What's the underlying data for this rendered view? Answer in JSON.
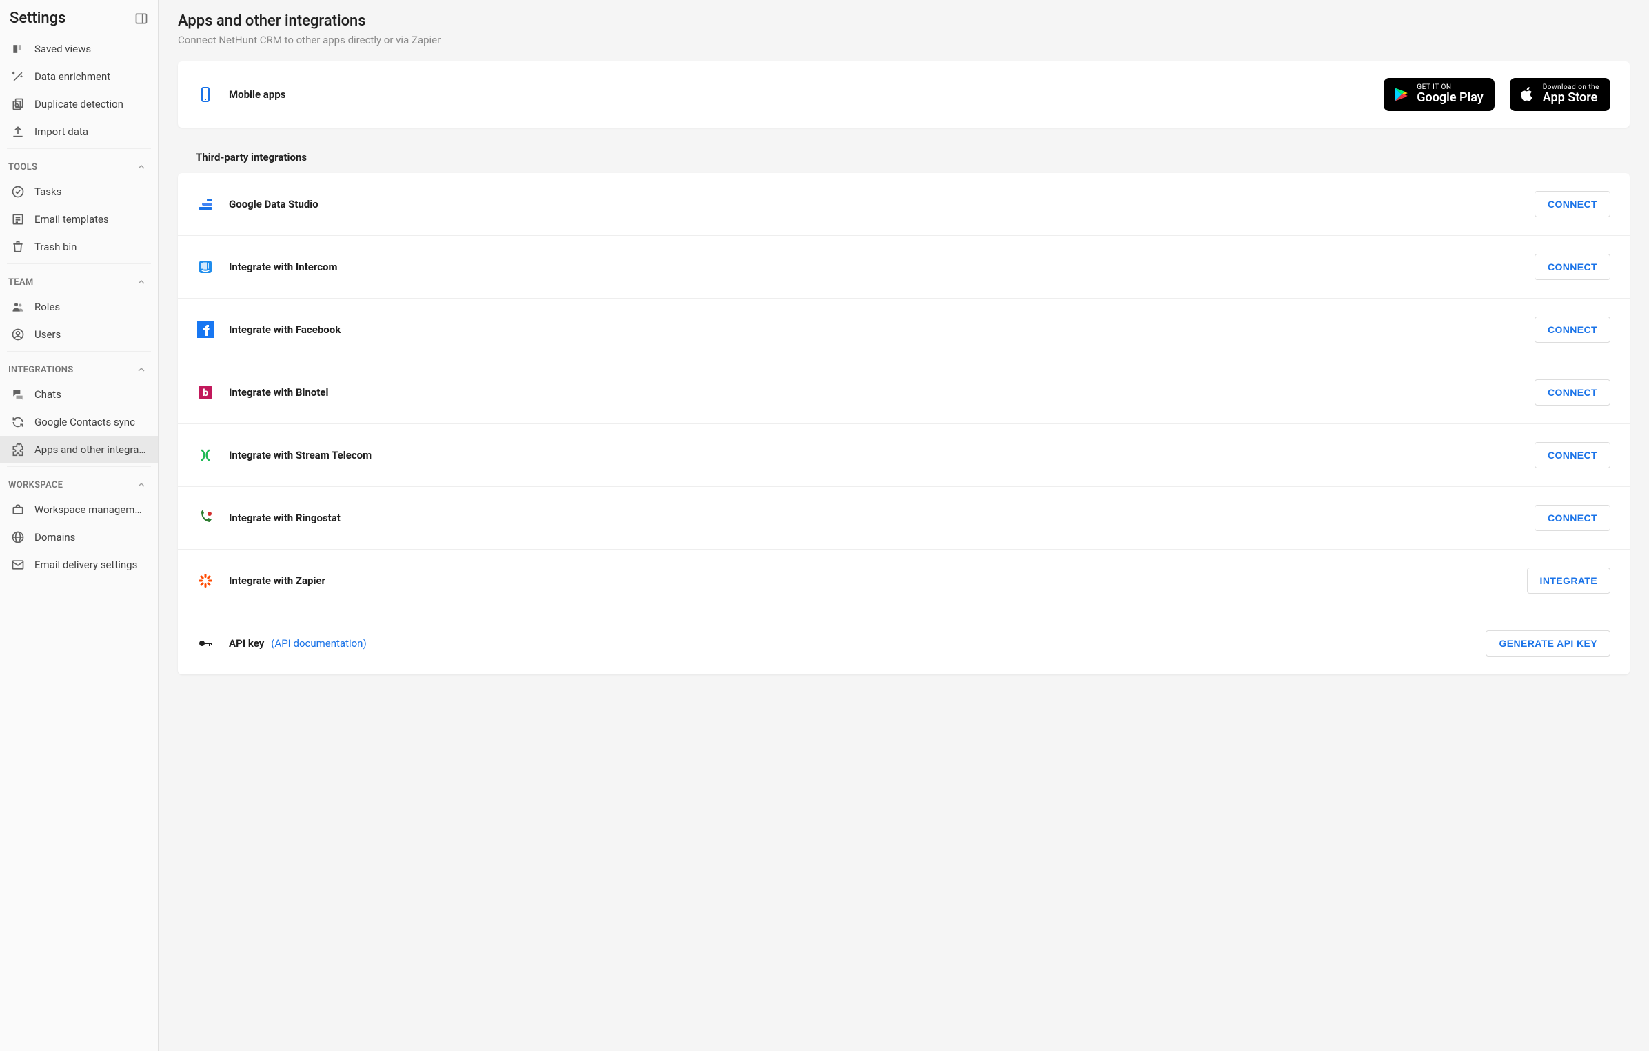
{
  "sidebar": {
    "title": "Settings",
    "top_items": [
      {
        "id": "saved-views",
        "label": "Saved views"
      },
      {
        "id": "data-enrichment",
        "label": "Data enrichment"
      },
      {
        "id": "duplicate-detection",
        "label": "Duplicate detection"
      },
      {
        "id": "import-data",
        "label": "Import data"
      }
    ],
    "sections": [
      {
        "id": "tools",
        "label": "TOOLS",
        "items": [
          {
            "id": "tasks",
            "label": "Tasks"
          },
          {
            "id": "email-templates",
            "label": "Email templates"
          },
          {
            "id": "trash-bin",
            "label": "Trash bin"
          }
        ]
      },
      {
        "id": "team",
        "label": "TEAM",
        "items": [
          {
            "id": "roles",
            "label": "Roles"
          },
          {
            "id": "users",
            "label": "Users"
          }
        ]
      },
      {
        "id": "integrations",
        "label": "INTEGRATIONS",
        "items": [
          {
            "id": "chats",
            "label": "Chats"
          },
          {
            "id": "google-contacts-sync",
            "label": "Google Contacts sync"
          },
          {
            "id": "apps-other-integrations",
            "label": "Apps and other integra…",
            "active": true
          }
        ]
      },
      {
        "id": "workspace",
        "label": "WORKSPACE",
        "items": [
          {
            "id": "workspace-management",
            "label": "Workspace manageme…"
          },
          {
            "id": "domains",
            "label": "Domains"
          },
          {
            "id": "email-delivery-settings",
            "label": "Email delivery settings"
          }
        ]
      }
    ]
  },
  "main": {
    "title": "Apps and other integrations",
    "subtitle": "Connect NetHunt CRM to other apps directly or via Zapier",
    "mobile": {
      "label": "Mobile apps",
      "google": {
        "line1": "GET IT ON",
        "line2": "Google Play"
      },
      "apple": {
        "line1": "Download on the",
        "line2": "App Store"
      }
    },
    "third_party_label": "Third-party integrations",
    "integrations": [
      {
        "id": "google-data-studio",
        "label": "Google Data Studio",
        "button": "CONNECT"
      },
      {
        "id": "intercom",
        "label": "Integrate with Intercom",
        "button": "CONNECT"
      },
      {
        "id": "facebook",
        "label": "Integrate with Facebook",
        "button": "CONNECT"
      },
      {
        "id": "binotel",
        "label": "Integrate with Binotel",
        "button": "CONNECT"
      },
      {
        "id": "stream-telecom",
        "label": "Integrate with Stream Telecom",
        "button": "CONNECT"
      },
      {
        "id": "ringostat",
        "label": "Integrate with Ringostat",
        "button": "CONNECT"
      },
      {
        "id": "zapier",
        "label": "Integrate with Zapier",
        "button": "INTEGRATE"
      },
      {
        "id": "api-key",
        "label": "API key",
        "link": "(API documentation)",
        "button": "GENERATE API KEY"
      }
    ]
  }
}
